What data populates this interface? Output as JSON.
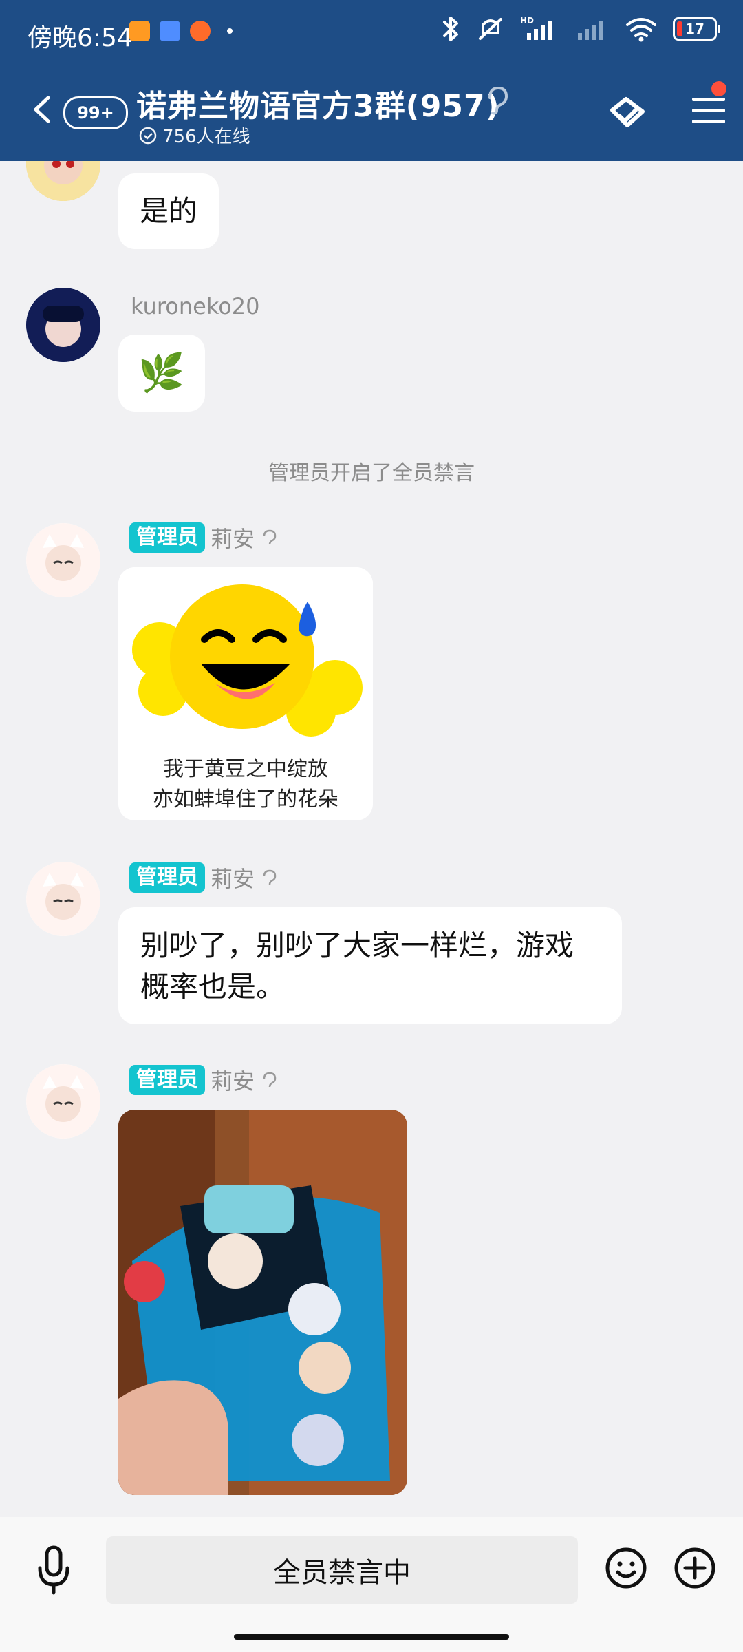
{
  "status": {
    "time": "傍晚6:54",
    "battery": "17"
  },
  "header": {
    "badge": "99+",
    "title": "诺弗兰物语官方3群(957)",
    "online": "756人在线"
  },
  "messages": [
    {
      "type": "text",
      "text": "是的"
    },
    {
      "type": "emoji",
      "name": "kuroneko20",
      "emoji": "🌿"
    },
    {
      "type": "system",
      "text": "管理员开启了全员禁言"
    },
    {
      "type": "sticker",
      "role": "管理员",
      "name": "莉安",
      "caption": [
        "我于黄豆之中绽放",
        "亦如蚌埠住了的花朵"
      ]
    },
    {
      "type": "text",
      "role": "管理员",
      "name": "莉安",
      "text": "别吵了，别吵了大家一样烂，游戏概率也是。"
    },
    {
      "type": "photo",
      "role": "管理员",
      "name": "莉安"
    }
  ],
  "input": {
    "placeholder": "全员禁言中"
  },
  "colors": {
    "header": "#1e4d86",
    "role_tag": "#14c4cf",
    "background": "#f1f1f3"
  }
}
